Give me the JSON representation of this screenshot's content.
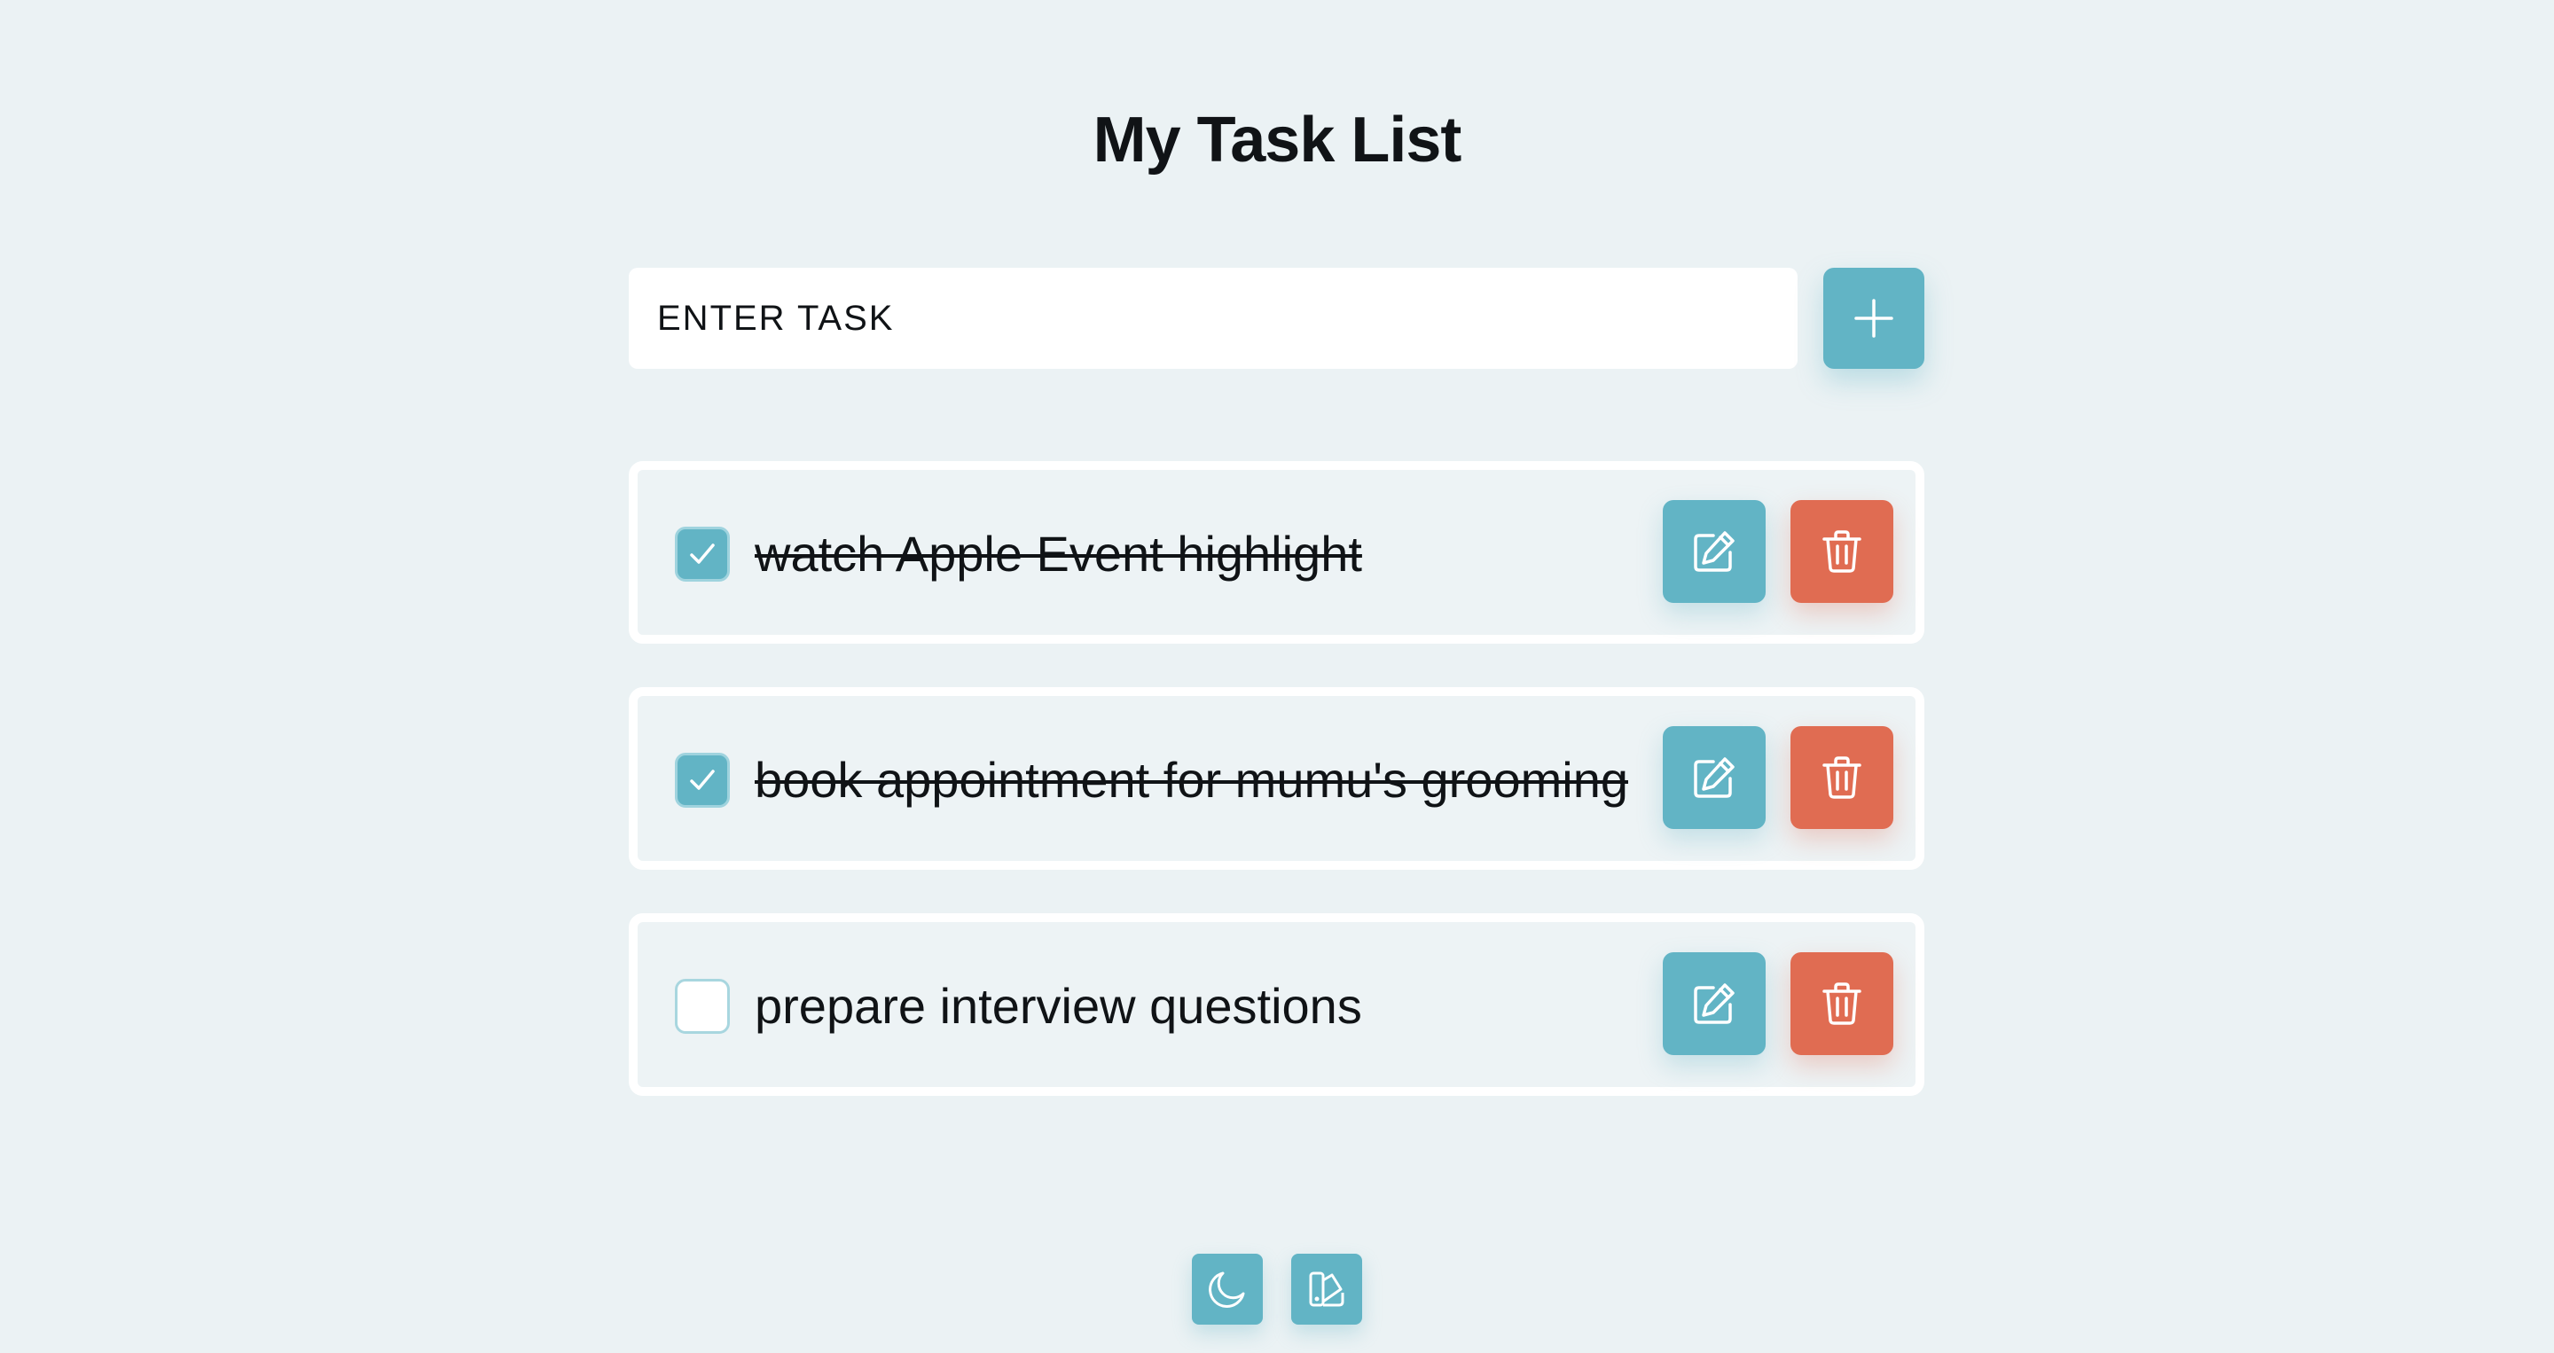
{
  "page": {
    "title": "My Task List"
  },
  "task_input": {
    "placeholder": "ENTER TASK",
    "value": ""
  },
  "add_button": {
    "icon": "plus-icon"
  },
  "tasks": [
    {
      "text": "watch Apple Event highlight",
      "completed": true
    },
    {
      "text": "book appointment for mumu's grooming",
      "completed": true
    },
    {
      "text": "prepare interview questions",
      "completed": false
    }
  ],
  "task_actions": {
    "edit_icon": "pencil-icon",
    "delete_icon": "trash-icon"
  },
  "footer": {
    "dark_mode_icon": "moon-icon",
    "theme_icon": "palette-icon"
  },
  "colors": {
    "background": "#ebf2f4",
    "accent": "#62b4c5",
    "danger": "#e06c52",
    "text": "#101316",
    "card_border": "#ffffff"
  }
}
